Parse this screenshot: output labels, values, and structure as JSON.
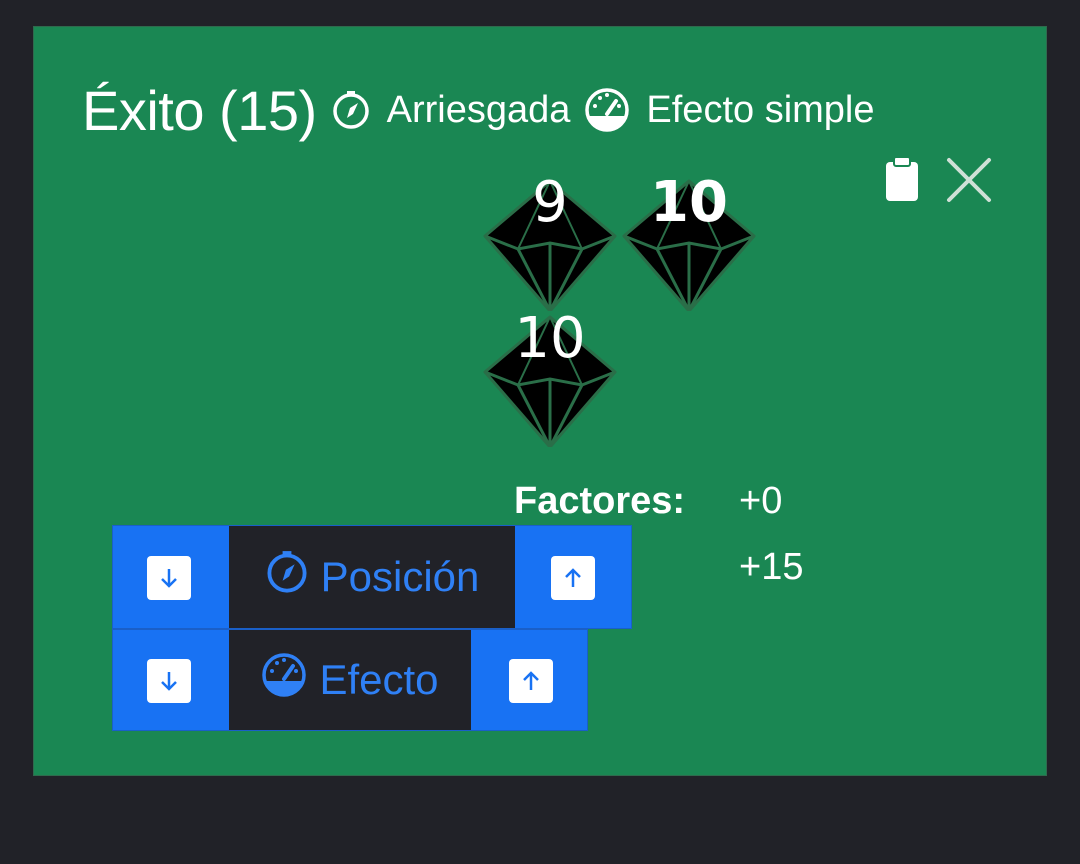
{
  "header": {
    "result_label": "Éxito (15)",
    "position_label": "Arriesgada",
    "effect_label": "Efecto simple"
  },
  "toolbar": {
    "copy_icon": "clipboard-icon",
    "close_icon": "close-icon"
  },
  "dice": [
    {
      "value": "9",
      "highlighted": false
    },
    {
      "value": "10",
      "highlighted": true
    },
    {
      "value": "10",
      "highlighted": false
    }
  ],
  "factors": {
    "label": "Factores:",
    "values": [
      "+0",
      "+15"
    ]
  },
  "controls": [
    {
      "label": "Posición",
      "icon": "compass-icon",
      "decrease_icon": "arrow-down-icon",
      "increase_icon": "arrow-up-icon"
    },
    {
      "label": "Efecto",
      "icon": "gauge-icon",
      "decrease_icon": "arrow-down-icon",
      "increase_icon": "arrow-up-icon"
    }
  ],
  "colors": {
    "background": "#212228",
    "card": "#1a8753",
    "control_strip": "#1872f3",
    "control_text": "#2f80f5",
    "die_fill": "#000000",
    "die_edges": "#2a6e48"
  }
}
